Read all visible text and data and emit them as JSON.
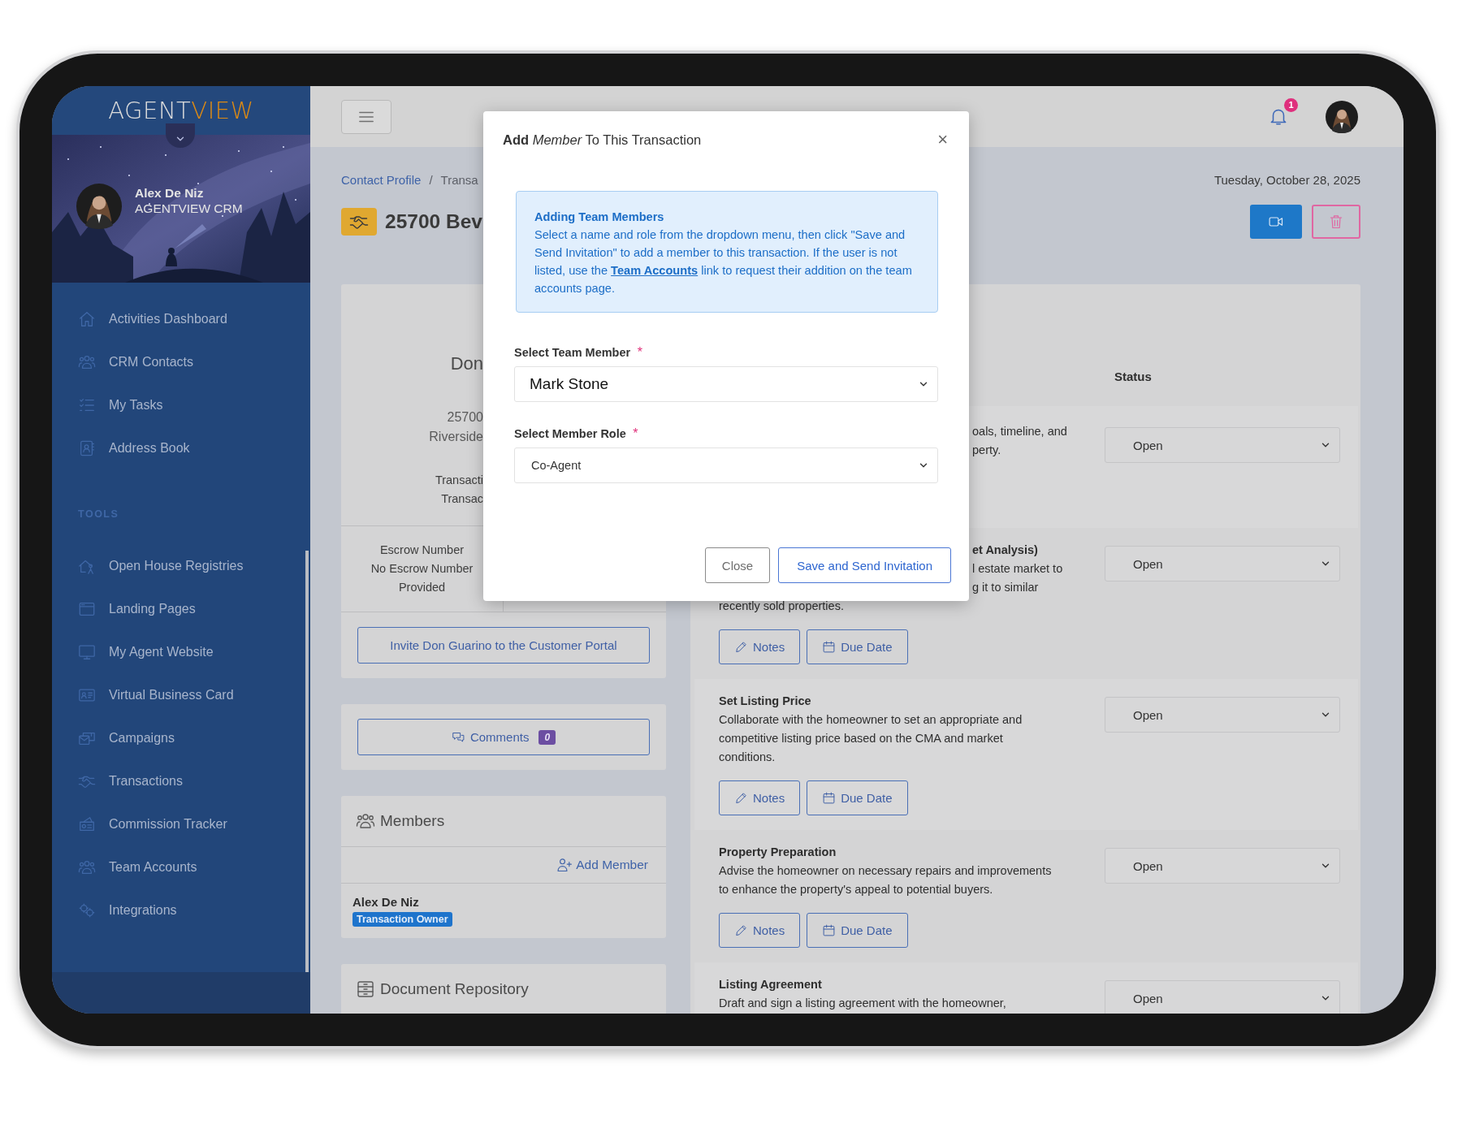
{
  "sidebar": {
    "logo": {
      "part_1": "AGENT",
      "part_2": "VIEW"
    },
    "profile": {
      "name": "Alex De Niz",
      "subtitle": "AGENTVIEW CRM"
    },
    "main_items": [
      {
        "label": "Activities Dashboard"
      },
      {
        "label": "CRM Contacts"
      },
      {
        "label": "My Tasks"
      },
      {
        "label": "Address Book"
      }
    ],
    "tools_heading": "TOOLS",
    "tool_items": [
      {
        "label": "Open House Registries"
      },
      {
        "label": "Landing Pages"
      },
      {
        "label": "My Agent Website"
      },
      {
        "label": "Virtual Business Card"
      },
      {
        "label": "Campaigns"
      },
      {
        "label": "Transactions"
      },
      {
        "label": "Commission Tracker"
      },
      {
        "label": "Team Accounts"
      },
      {
        "label": "Integrations"
      }
    ]
  },
  "topbar": {
    "notification_count": "1"
  },
  "breadcrumb": {
    "separator": "/",
    "items": [
      {
        "label": "Contact Profile",
        "kind": "link"
      },
      {
        "label": "Transa",
        "kind": "current"
      }
    ]
  },
  "date": "Tuesday, October 28, 2025",
  "page_title": "25700 Bev",
  "profile_card": {
    "name": "Don",
    "address_lines": [
      "25700",
      "Riverside"
    ],
    "transaction_lines": [
      "Transacti",
      "Transac"
    ],
    "escrow_lines": [
      "Escrow Number",
      "No Escrow Number",
      "Provided"
    ],
    "invite_button": "Invite Don Guarino to the Customer Portal"
  },
  "comments": {
    "label": "Comments",
    "count": "0"
  },
  "members": {
    "title": "Members",
    "add_label": "Add Member",
    "list": [
      {
        "name": "Alex De Niz",
        "role": "Transaction Owner"
      }
    ]
  },
  "documents": {
    "title": "Document Repository"
  },
  "tasks": {
    "status_heading": "Status",
    "items": [
      {
        "lines": [
          {
            "text": "oals, timeline, and",
            "behind_dialog": true
          },
          {
            "text": "perty.",
            "behind_dialog": true
          }
        ],
        "status": "Open"
      },
      {
        "title": {
          "text": "et Analysis)",
          "behind_dialog": true
        },
        "lines": [
          {
            "text": "l estate market to",
            "behind_dialog": true
          },
          {
            "text": "g it to similar",
            "behind_dialog": true
          },
          {
            "text": "recently sold properties."
          }
        ],
        "status": "Open",
        "actions": [
          {
            "label": "Notes",
            "kind": "notes"
          },
          {
            "label": "Due Date",
            "kind": "due_date"
          }
        ]
      },
      {
        "title": {
          "text": "Set Listing Price"
        },
        "lines": [
          {
            "text": "Collaborate with the homeowner to set an appropriate and"
          },
          {
            "text": "competitive listing price based on the CMA and market"
          },
          {
            "text": "conditions."
          }
        ],
        "status": "Open",
        "actions": [
          {
            "label": "Notes",
            "kind": "notes"
          },
          {
            "label": "Due Date",
            "kind": "due_date"
          }
        ]
      },
      {
        "title": {
          "text": "Property Preparation"
        },
        "lines": [
          {
            "text": "Advise the homeowner on necessary repairs and improvements"
          },
          {
            "text": "to enhance the property's appeal to potential buyers."
          }
        ],
        "status": "Open",
        "actions": [
          {
            "label": "Notes",
            "kind": "notes"
          },
          {
            "label": "Due Date",
            "kind": "due_date"
          }
        ]
      },
      {
        "title": {
          "text": "Listing Agreement"
        },
        "lines": [
          {
            "text": "Draft and sign a listing agreement with the homeowner,"
          }
        ],
        "status": "Open"
      }
    ]
  },
  "dialog": {
    "title": "**Add** *Member* To This Transaction",
    "close_symbol": "×",
    "info": {
      "title": "Adding Team Members",
      "text_before": "Select a name and role from the dropdown menu, then click \"Save and Send Invitation\" to add a member to this transaction. If the user is not listed, use the ",
      "link": "Team Accounts",
      "text_after": " link to request their addition on the team accounts page."
    },
    "fields": [
      {
        "label": "Select Team Member",
        "required_mark": "*",
        "value": "Mark Stone",
        "kind": "large"
      },
      {
        "label": "Select Member Role",
        "required_mark": "*",
        "value": "Co-Agent",
        "kind": "normal"
      }
    ],
    "buttons": [
      {
        "label": "Close",
        "kind": "secondary"
      },
      {
        "label": "Save and Send Invitation",
        "kind": "primary"
      }
    ]
  }
}
